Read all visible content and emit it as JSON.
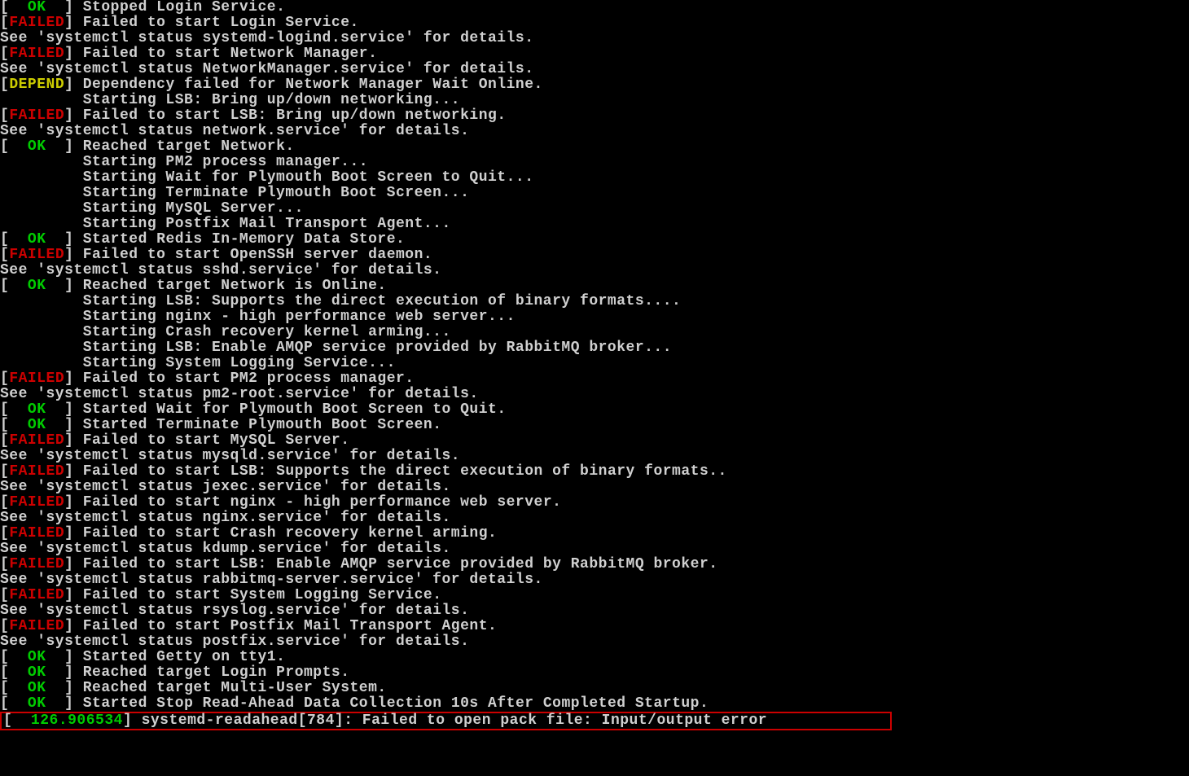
{
  "tokens": {
    "lb": "[",
    "rb": "]",
    "sp1": " ",
    "sp2": "  ",
    "sp3": "   ",
    "sp4": "    ",
    "sp9": "         ",
    "ok": "OK",
    "failed": "FAILED",
    "depend": "DEPEND"
  },
  "lines": [
    {
      "type": "status",
      "status": "ok",
      "msg": " Stopped Login Service."
    },
    {
      "type": "status",
      "status": "failed",
      "msg": " Failed to start Login Service."
    },
    {
      "type": "plain",
      "msg": "See 'systemctl status systemd-logind.service' for details."
    },
    {
      "type": "status",
      "status": "failed",
      "msg": " Failed to start Network Manager."
    },
    {
      "type": "plain",
      "msg": "See 'systemctl status NetworkManager.service' for details."
    },
    {
      "type": "status",
      "status": "depend",
      "msg": " Dependency failed for Network Manager Wait Online."
    },
    {
      "type": "indent",
      "msg": "Starting LSB: Bring up/down networking..."
    },
    {
      "type": "status",
      "status": "failed",
      "msg": " Failed to start LSB: Bring up/down networking."
    },
    {
      "type": "plain",
      "msg": "See 'systemctl status network.service' for details."
    },
    {
      "type": "status",
      "status": "ok",
      "msg": " Reached target Network."
    },
    {
      "type": "indent",
      "msg": "Starting PM2 process manager..."
    },
    {
      "type": "indent",
      "msg": "Starting Wait for Plymouth Boot Screen to Quit..."
    },
    {
      "type": "indent",
      "msg": "Starting Terminate Plymouth Boot Screen..."
    },
    {
      "type": "indent",
      "msg": "Starting MySQL Server..."
    },
    {
      "type": "indent",
      "msg": "Starting Postfix Mail Transport Agent..."
    },
    {
      "type": "status",
      "status": "ok",
      "msg": " Started Redis In-Memory Data Store."
    },
    {
      "type": "status",
      "status": "failed",
      "msg": " Failed to start OpenSSH server daemon."
    },
    {
      "type": "plain",
      "msg": "See 'systemctl status sshd.service' for details."
    },
    {
      "type": "status",
      "status": "ok",
      "msg": " Reached target Network is Online."
    },
    {
      "type": "indent",
      "msg": "Starting LSB: Supports the direct execution of binary formats...."
    },
    {
      "type": "indent",
      "msg": "Starting nginx - high performance web server..."
    },
    {
      "type": "indent",
      "msg": "Starting Crash recovery kernel arming..."
    },
    {
      "type": "indent",
      "msg": "Starting LSB: Enable AMQP service provided by RabbitMQ broker..."
    },
    {
      "type": "indent",
      "msg": "Starting System Logging Service..."
    },
    {
      "type": "status",
      "status": "failed",
      "msg": " Failed to start PM2 process manager."
    },
    {
      "type": "plain",
      "msg": "See 'systemctl status pm2-root.service' for details."
    },
    {
      "type": "status",
      "status": "ok",
      "msg": " Started Wait for Plymouth Boot Screen to Quit."
    },
    {
      "type": "status",
      "status": "ok",
      "msg": " Started Terminate Plymouth Boot Screen."
    },
    {
      "type": "status",
      "status": "failed",
      "msg": " Failed to start MySQL Server."
    },
    {
      "type": "plain",
      "msg": "See 'systemctl status mysqld.service' for details."
    },
    {
      "type": "status",
      "status": "failed",
      "msg": " Failed to start LSB: Supports the direct execution of binary formats.."
    },
    {
      "type": "plain",
      "msg": "See 'systemctl status jexec.service' for details."
    },
    {
      "type": "status",
      "status": "failed",
      "msg": " Failed to start nginx - high performance web server."
    },
    {
      "type": "plain",
      "msg": "See 'systemctl status nginx.service' for details."
    },
    {
      "type": "status",
      "status": "failed",
      "msg": " Failed to start Crash recovery kernel arming."
    },
    {
      "type": "plain",
      "msg": "See 'systemctl status kdump.service' for details."
    },
    {
      "type": "status",
      "status": "failed",
      "msg": " Failed to start LSB: Enable AMQP service provided by RabbitMQ broker."
    },
    {
      "type": "plain",
      "msg": "See 'systemctl status rabbitmq-server.service' for details."
    },
    {
      "type": "status",
      "status": "failed",
      "msg": " Failed to start System Logging Service."
    },
    {
      "type": "plain",
      "msg": "See 'systemctl status rsyslog.service' for details."
    },
    {
      "type": "status",
      "status": "failed",
      "msg": " Failed to start Postfix Mail Transport Agent."
    },
    {
      "type": "plain",
      "msg": "See 'systemctl status postfix.service' for details."
    },
    {
      "type": "status",
      "status": "ok",
      "msg": " Started Getty on tty1."
    },
    {
      "type": "status",
      "status": "ok",
      "msg": " Reached target Login Prompts."
    },
    {
      "type": "status",
      "status": "ok",
      "msg": " Reached target Multi-User System."
    },
    {
      "type": "status",
      "status": "ok",
      "msg": " Started Stop Read-Ahead Data Collection 10s After Completed Startup."
    }
  ],
  "highlight": {
    "timestamp": "126.906534",
    "msg": " systemd-readahead[784]: Failed to open pack file: Input/output error"
  }
}
